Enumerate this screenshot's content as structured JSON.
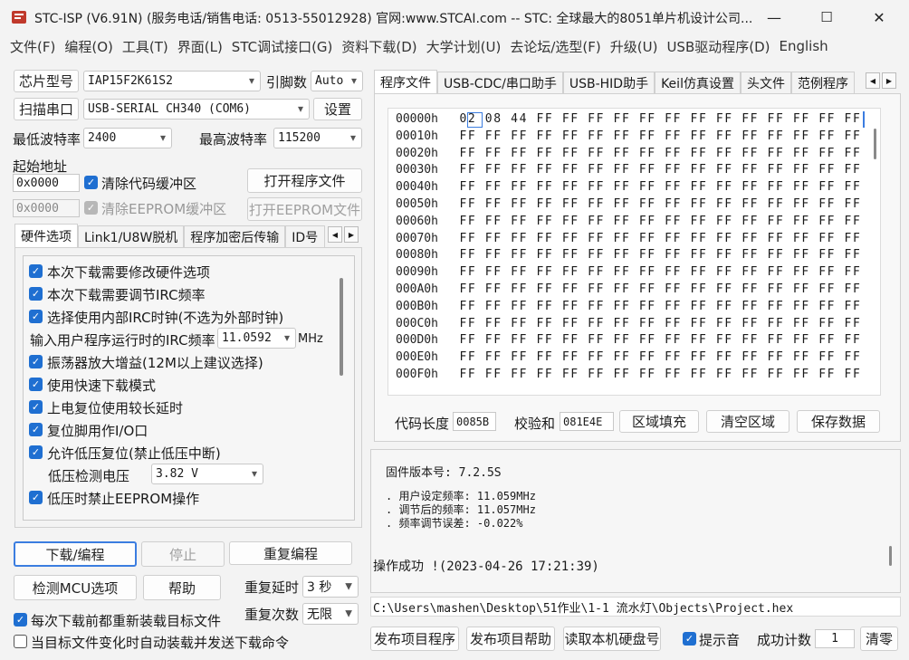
{
  "window": {
    "title": "STC-ISP (V6.91N) (服务电话/销售电话: 0513-55012928) 官网:www.STCAI.com  -- STC: 全球最大的8051单片机设计公司...",
    "minimize": "—",
    "maximize": "☐",
    "close": "✕"
  },
  "menu": [
    "文件(F)",
    "编程(O)",
    "工具(T)",
    "界面(L)",
    "STC调试接口(G)",
    "资料下载(D)",
    "大学计划(U)",
    "去论坛/选型(F)",
    "升级(U)",
    "USB驱动程序(D)",
    "English"
  ],
  "left": {
    "chip_btn": "芯片型号",
    "chip_value": "IAP15F2K61S2",
    "pins_label": "引脚数",
    "pins_value": "Auto",
    "scan_btn": "扫描串口",
    "port_value": "USB-SERIAL CH340 (COM6)",
    "settings_btn": "设置",
    "min_baud_label": "最低波特率",
    "min_baud_value": "2400",
    "max_baud_label": "最高波特率",
    "max_baud_value": "115200",
    "start_addr_label": "起始地址",
    "addr1": "0x0000",
    "clear_code_label": "清除代码缓冲区",
    "open_prog_btn": "打开程序文件",
    "addr2": "0x0000",
    "clear_eeprom_label": "清除EEPROM缓冲区",
    "open_eeprom_btn": "打开EEPROM文件",
    "tabs": [
      "硬件选项",
      "Link1/U8W脱机",
      "程序加密后传输",
      "ID号"
    ],
    "options": [
      "本次下载需要修改硬件选项",
      "本次下载需要调节IRC频率",
      "选择使用内部IRC时钟(不选为外部时钟)"
    ],
    "irc_label": "输入用户程序运行时的IRC频率",
    "irc_value": "11.0592",
    "irc_unit": "MHz",
    "options2": [
      "振荡器放大增益(12M以上建议选择)",
      "使用快速下载模式",
      "上电复位使用较长延时",
      "复位脚用作I/O口",
      "允许低压复位(禁止低压中断)"
    ],
    "lv_label": "低压检测电压",
    "lv_value": "3.82 V",
    "option_last": "低压时禁止EEPROM操作",
    "download_btn": "下载/编程",
    "stop_btn": "停止",
    "reprogram_btn": "重复编程",
    "detect_btn": "检测MCU选项",
    "help_btn": "帮助",
    "repeat_delay_label": "重复延时",
    "repeat_delay_value": "3 秒",
    "repeat_count_label": "重复次数",
    "repeat_count_value": "无限",
    "reload_label": "每次下载前都重新装载目标文件",
    "autoload_label": "当目标文件变化时自动装载并发送下载命令"
  },
  "right": {
    "tabs": [
      "程序文件",
      "USB-CDC/串口助手",
      "USB-HID助手",
      "Keil仿真设置",
      "头文件",
      "范例程序"
    ],
    "hex_rows": [
      {
        "addr": "00000h",
        "bytes": "02 08 44 FF FF FF FF FF FF FF FF FF FF FF FF FF"
      },
      {
        "addr": "00010h",
        "bytes": "FF FF FF FF FF FF FF FF FF FF FF FF FF FF FF FF"
      },
      {
        "addr": "00020h",
        "bytes": "FF FF FF FF FF FF FF FF FF FF FF FF FF FF FF FF"
      },
      {
        "addr": "00030h",
        "bytes": "FF FF FF FF FF FF FF FF FF FF FF FF FF FF FF FF"
      },
      {
        "addr": "00040h",
        "bytes": "FF FF FF FF FF FF FF FF FF FF FF FF FF FF FF FF"
      },
      {
        "addr": "00050h",
        "bytes": "FF FF FF FF FF FF FF FF FF FF FF FF FF FF FF FF"
      },
      {
        "addr": "00060h",
        "bytes": "FF FF FF FF FF FF FF FF FF FF FF FF FF FF FF FF"
      },
      {
        "addr": "00070h",
        "bytes": "FF FF FF FF FF FF FF FF FF FF FF FF FF FF FF FF"
      },
      {
        "addr": "00080h",
        "bytes": "FF FF FF FF FF FF FF FF FF FF FF FF FF FF FF FF"
      },
      {
        "addr": "00090h",
        "bytes": "FF FF FF FF FF FF FF FF FF FF FF FF FF FF FF FF"
      },
      {
        "addr": "000A0h",
        "bytes": "FF FF FF FF FF FF FF FF FF FF FF FF FF FF FF FF"
      },
      {
        "addr": "000B0h",
        "bytes": "FF FF FF FF FF FF FF FF FF FF FF FF FF FF FF FF"
      },
      {
        "addr": "000C0h",
        "bytes": "FF FF FF FF FF FF FF FF FF FF FF FF FF FF FF FF"
      },
      {
        "addr": "000D0h",
        "bytes": "FF FF FF FF FF FF FF FF FF FF FF FF FF FF FF FF"
      },
      {
        "addr": "000E0h",
        "bytes": "FF FF FF FF FF FF FF FF FF FF FF FF FF FF FF FF"
      },
      {
        "addr": "000F0h",
        "bytes": "FF FF FF FF FF FF FF FF FF FF FF FF FF FF FF FF"
      }
    ],
    "code_len_label": "代码长度",
    "code_len_value": "0085B",
    "checksum_label": "校验和",
    "checksum_value": "081E4E",
    "fill_btn": "区域填充",
    "clear_btn": "清空区域",
    "save_btn": "保存数据",
    "log_firmware": "固件版本号: 7.2.5S",
    "log_lines": [
      ". 用户设定频率: 11.059MHz",
      ". 调节后的频率: 11.057MHz",
      ". 频率调节误差: -0.022%"
    ],
    "log_success": "操作成功 !(2023-04-26 17:21:39)",
    "path": "C:\\Users\\mashen\\Desktop\\51作业\\1-1 流水灯\\Objects\\Project.hex",
    "publish_btn": "发布项目程序",
    "publish_help_btn": "发布项目帮助",
    "read_hdd_btn": "读取本机硬盘号",
    "beep_label": "提示音",
    "success_count_label": "成功计数",
    "success_count_value": "1",
    "clear_count_btn": "清零"
  }
}
